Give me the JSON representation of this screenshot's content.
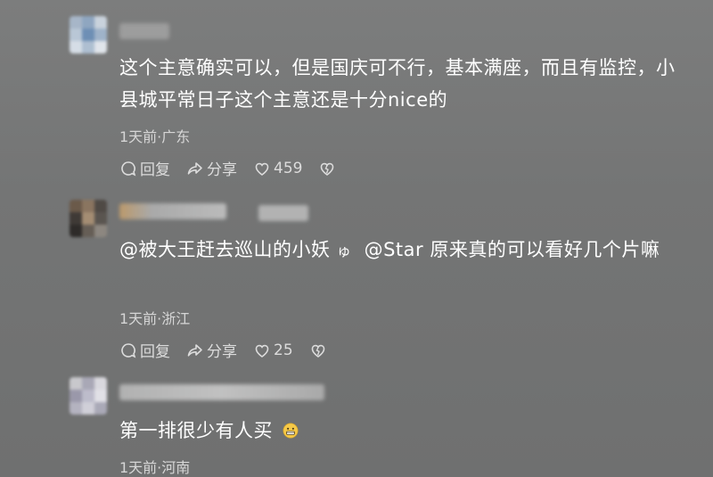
{
  "comments": [
    {
      "text": "这个主意确实可以，但是国庆可不行，基本满座，而且有监控，小县城平常日子这个主意还是十分nice的",
      "meta": "1天前·广东",
      "reply_label": "回复",
      "share_label": "分享",
      "likes": "459",
      "icons": [
        "reply-icon",
        "share-icon",
        "like-icon",
        "dislike-icon"
      ]
    },
    {
      "mention1": "@被大王赶去巡山的小妖",
      "mention1_symbol": "ゅ",
      "mention2": "@Star",
      "text": "原来真的可以看好几个片嘛",
      "meta": "1天前·浙江",
      "reply_label": "回复",
      "share_label": "分享",
      "likes": "25",
      "icons": [
        "reply-icon",
        "share-icon",
        "like-icon",
        "dislike-icon"
      ]
    },
    {
      "text": "第一排很少有人买",
      "emoji": "grimace-emoji",
      "meta": "1天前·河南"
    }
  ],
  "colors": {
    "background": "#767777",
    "text": "#ffffff",
    "meta": "#d6d6d6"
  }
}
